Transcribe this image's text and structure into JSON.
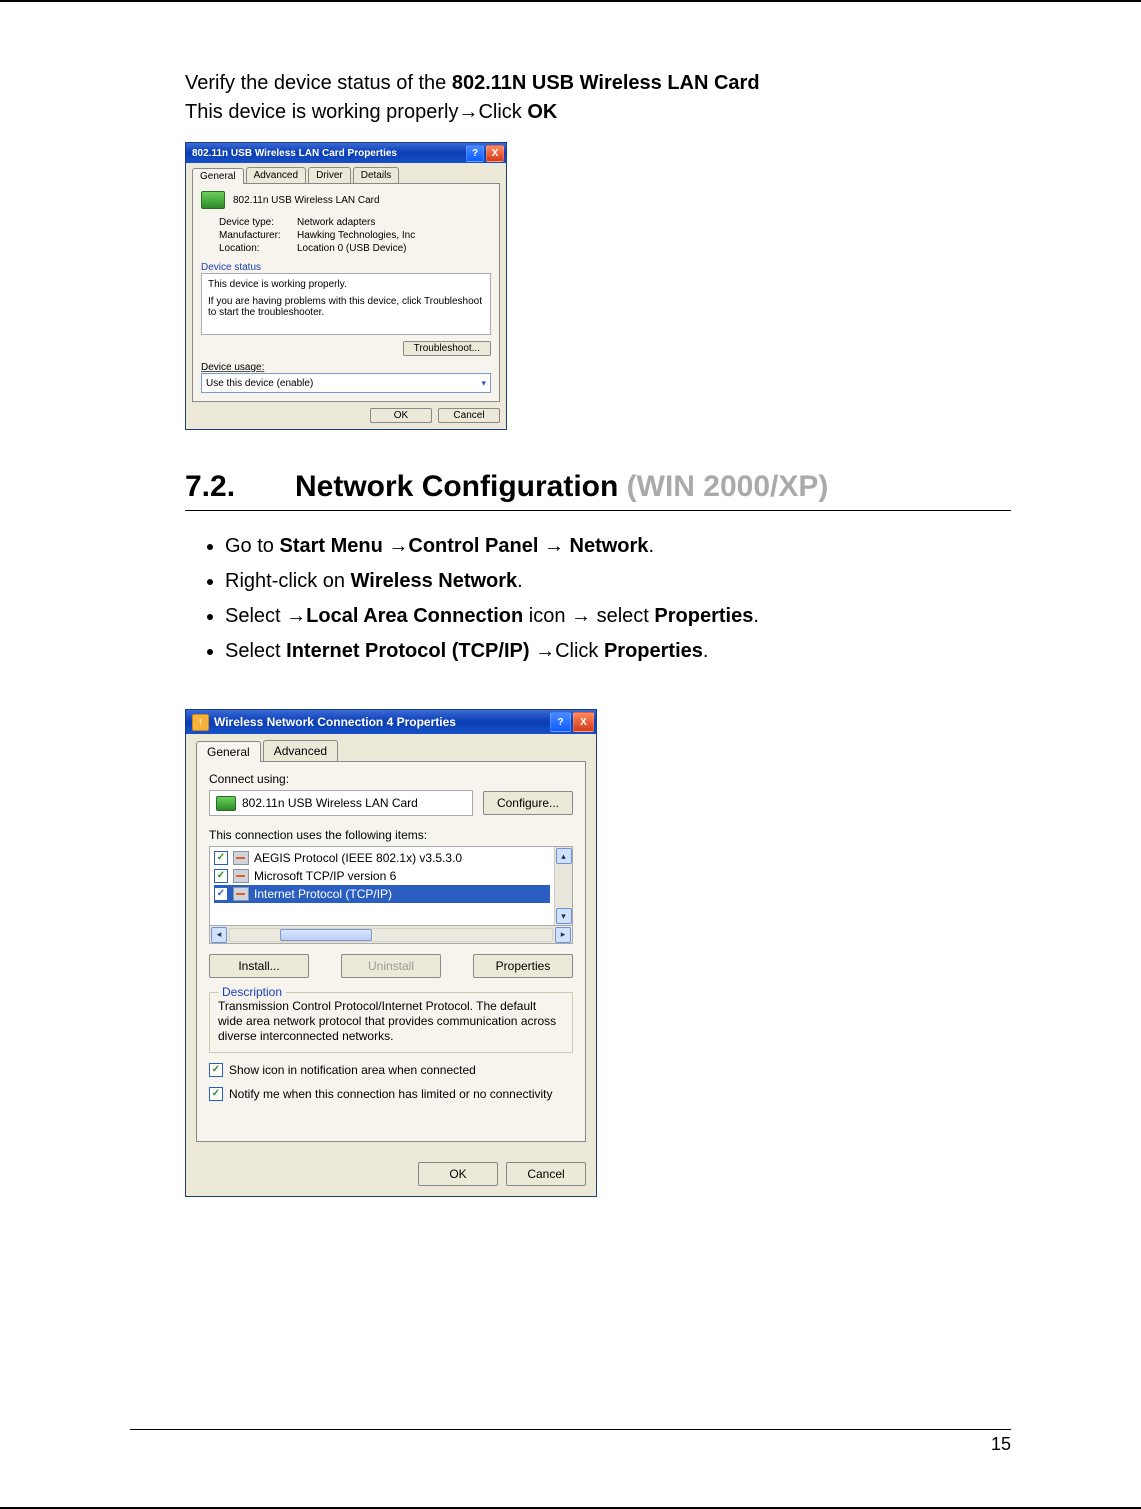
{
  "intro": {
    "line1_pre": "Verify the device status of the ",
    "line1_bold": "802.11N USB Wireless LAN Card",
    "line2_pre": "This device is working properly",
    "line2_click": "Click ",
    "line2_ok": "OK"
  },
  "arrow": "→",
  "dialog1": {
    "title": "802.11n USB Wireless LAN Card Properties",
    "help": "?",
    "close": "X",
    "tabs": [
      "General",
      "Advanced",
      "Driver",
      "Details"
    ],
    "device_name": "802.11n USB Wireless LAN Card",
    "props": {
      "type_label": "Device type:",
      "type_value": "Network adapters",
      "mfr_label": "Manufacturer:",
      "mfr_value": "Hawking Technologies, Inc",
      "loc_label": "Location:",
      "loc_value": "Location 0 (USB Device)"
    },
    "status_label": "Device status",
    "status_line1": "This device is working properly.",
    "status_line2": "If you are having problems with this device, click Troubleshoot to start the troubleshooter.",
    "troubleshoot": "Troubleshoot...",
    "usage_label": "Device usage:",
    "usage_value": "Use this device (enable)",
    "ok_label": "OK",
    "cancel_label": "Cancel"
  },
  "section": {
    "num": "7.2.",
    "title": "Network Configuration ",
    "gray": "(WIN 2000/XP)"
  },
  "bullets": {
    "b1": {
      "a": "Go to ",
      "b": "Start Menu ",
      "c": "Control Panel ",
      "d": " Network",
      "e": "."
    },
    "b2": {
      "a": "Right-click on ",
      "b": "Wireless Network",
      "c": "."
    },
    "b3": {
      "a": "Select ",
      "b": "Local Area Connection",
      "c": " icon ",
      "d": " select ",
      "e": "Properties",
      "f": "."
    },
    "b4": {
      "a": "Select ",
      "b": "Internet Protocol (TCP/IP) ",
      "c": "Click ",
      "d": "Properties",
      "e": "."
    }
  },
  "dialog2": {
    "upicon": "↑",
    "title": "Wireless Network Connection 4 Properties",
    "help": "?",
    "close": "X",
    "tabs": [
      "General",
      "Advanced"
    ],
    "connect_label": "Connect using:",
    "adapter": "802.11n USB Wireless LAN Card",
    "configure": "Configure...",
    "items_label": "This connection uses the following items:",
    "item1": "AEGIS Protocol (IEEE 802.1x) v3.5.3.0",
    "item2": "Microsoft TCP/IP version 6",
    "item3": "Internet Protocol (TCP/IP)",
    "install": "Install...",
    "uninstall": "Uninstall",
    "properties": "Properties",
    "desc_label": "Description",
    "desc_text": "Transmission Control Protocol/Internet Protocol. The default wide area network protocol that provides communication across diverse interconnected networks.",
    "chk1": "Show icon in notification area when connected",
    "chk2": "Notify me when this connection has limited or no connectivity",
    "ok_label": "OK",
    "cancel_label": "Cancel"
  },
  "page_number": "15",
  "checkmark": "✓",
  "dd_arrow": "▾",
  "up_c": "▴",
  "down_c": "▾",
  "left_c": "◂",
  "right_c": "▸"
}
